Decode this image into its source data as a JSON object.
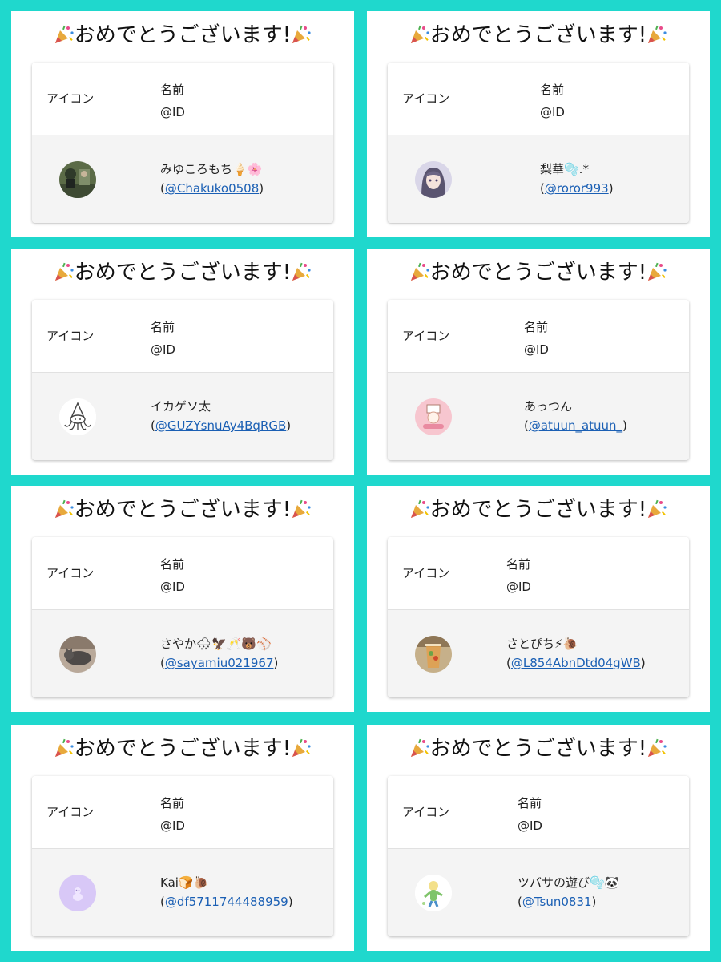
{
  "title": "おめでとうございます!",
  "header": {
    "icon_label": "アイコン",
    "name_label": "名前",
    "id_label": "@ID"
  },
  "accent_color": "#1fd8cd",
  "link_color": "#1a5fb4",
  "winners": [
    {
      "name": "みゆころもち🍦🌸",
      "handle": "@Chakuko0508",
      "avatar": "photo-avatar"
    },
    {
      "name": "梨華🫧.*",
      "handle": "@roror993",
      "avatar": "anime-girl-avatar"
    },
    {
      "name": "イカゲソ太",
      "handle": "@GUZYsnuAy4BqRGB",
      "avatar": "squid-avatar"
    },
    {
      "name": "あっつん",
      "handle": "@atuun_atuun_",
      "avatar": "pink-badge-avatar"
    },
    {
      "name": "さやか🌨🦅🥂🐻⚾",
      "handle": "@sayamiu021967",
      "avatar": "cat-photo-avatar"
    },
    {
      "name": "さとぴち⚡🐌",
      "handle": "@L854AbnDtd04gWB",
      "avatar": "drink-photo-avatar"
    },
    {
      "name": "Kai🍞🐌",
      "handle": "@df5711744488959",
      "avatar": "lavender-avatar"
    },
    {
      "name": "ツバサの遊び🫧🐼",
      "handle": "@Tsun0831",
      "avatar": "character-avatar"
    }
  ]
}
